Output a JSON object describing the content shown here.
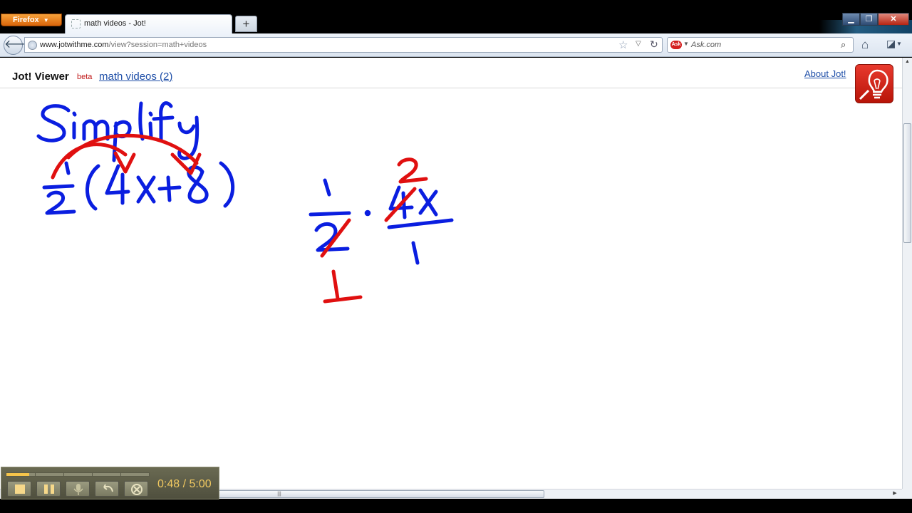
{
  "browser": {
    "menu_button_label": "Firefox",
    "tab_title": "math videos - Jot!",
    "new_tab_label": "+",
    "url_host": "www.jotwithme.com",
    "url_path": "/view?session=math+videos",
    "search_placeholder": "Ask.com",
    "search_engine_badge": "Ask"
  },
  "app": {
    "title": "Jot! Viewer",
    "beta_label": "beta",
    "session_link": "math videos (2)",
    "about_link": "About Jot!"
  },
  "whiteboard": {
    "ink_colors": {
      "blue": "#0a1ee0",
      "red": "#e01010"
    },
    "content": "Simplify 1/2 (4x+8) ; 1/2 · 4x/1 with 2 and 4 cancelled to 1 and 2"
  },
  "recorder": {
    "progress_fraction": 0.16,
    "elapsed": "0:48",
    "separator": " / ",
    "total": "5:00",
    "accent_color": "#f5c44a"
  }
}
